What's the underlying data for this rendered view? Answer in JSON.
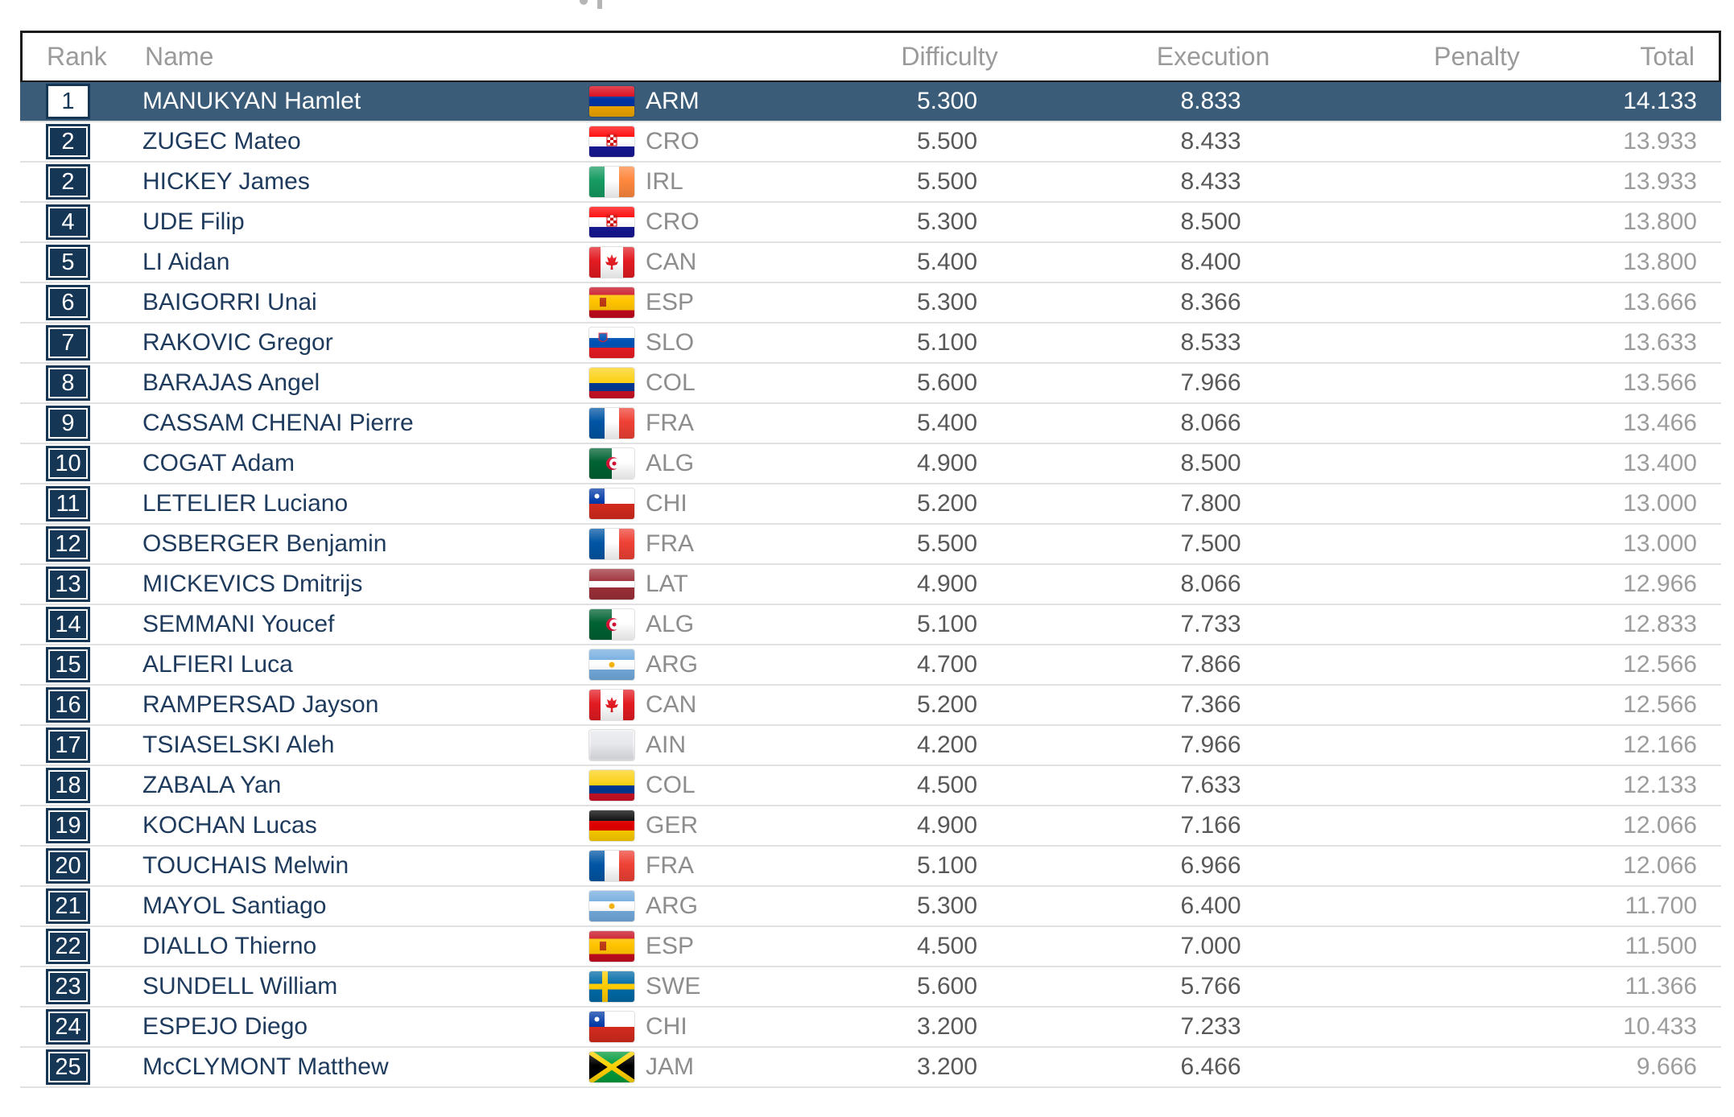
{
  "table": {
    "columns": {
      "rank": "Rank",
      "name": "Name",
      "difficulty": "Difficulty",
      "execution": "Execution",
      "penalty": "Penalty",
      "total": "Total"
    },
    "rows": [
      {
        "rank": "1",
        "name": "MANUKYAN Hamlet",
        "nation": "ARM",
        "flag": "armenia-flag-icon",
        "difficulty": "5.300",
        "execution": "8.833",
        "penalty": "",
        "total": "14.133",
        "highlighted": true
      },
      {
        "rank": "2",
        "name": "ZUGEC Mateo",
        "nation": "CRO",
        "flag": "croatia-flag-icon",
        "difficulty": "5.500",
        "execution": "8.433",
        "penalty": "",
        "total": "13.933"
      },
      {
        "rank": "2",
        "name": "HICKEY James",
        "nation": "IRL",
        "flag": "ireland-flag-icon",
        "difficulty": "5.500",
        "execution": "8.433",
        "penalty": "",
        "total": "13.933"
      },
      {
        "rank": "4",
        "name": "UDE Filip",
        "nation": "CRO",
        "flag": "croatia-flag-icon",
        "difficulty": "5.300",
        "execution": "8.500",
        "penalty": "",
        "total": "13.800"
      },
      {
        "rank": "5",
        "name": "LI Aidan",
        "nation": "CAN",
        "flag": "canada-flag-icon",
        "difficulty": "5.400",
        "execution": "8.400",
        "penalty": "",
        "total": "13.800"
      },
      {
        "rank": "6",
        "name": "BAIGORRI Unai",
        "nation": "ESP",
        "flag": "spain-flag-icon",
        "difficulty": "5.300",
        "execution": "8.366",
        "penalty": "",
        "total": "13.666"
      },
      {
        "rank": "7",
        "name": "RAKOVIC Gregor",
        "nation": "SLO",
        "flag": "slovenia-flag-icon",
        "difficulty": "5.100",
        "execution": "8.533",
        "penalty": "",
        "total": "13.633"
      },
      {
        "rank": "8",
        "name": "BARAJAS Angel",
        "nation": "COL",
        "flag": "colombia-flag-icon",
        "difficulty": "5.600",
        "execution": "7.966",
        "penalty": "",
        "total": "13.566"
      },
      {
        "rank": "9",
        "name": "CASSAM CHENAI Pierre",
        "nation": "FRA",
        "flag": "france-flag-icon",
        "difficulty": "5.400",
        "execution": "8.066",
        "penalty": "",
        "total": "13.466"
      },
      {
        "rank": "10",
        "name": "COGAT Adam",
        "nation": "ALG",
        "flag": "algeria-flag-icon",
        "difficulty": "4.900",
        "execution": "8.500",
        "penalty": "",
        "total": "13.400"
      },
      {
        "rank": "11",
        "name": "LETELIER Luciano",
        "nation": "CHI",
        "flag": "chile-flag-icon",
        "difficulty": "5.200",
        "execution": "7.800",
        "penalty": "",
        "total": "13.000"
      },
      {
        "rank": "12",
        "name": "OSBERGER Benjamin",
        "nation": "FRA",
        "flag": "france-flag-icon",
        "difficulty": "5.500",
        "execution": "7.500",
        "penalty": "",
        "total": "13.000"
      },
      {
        "rank": "13",
        "name": "MICKEVICS Dmitrijs",
        "nation": "LAT",
        "flag": "latvia-flag-icon",
        "difficulty": "4.900",
        "execution": "8.066",
        "penalty": "",
        "total": "12.966"
      },
      {
        "rank": "14",
        "name": "SEMMANI Youcef",
        "nation": "ALG",
        "flag": "algeria-flag-icon",
        "difficulty": "5.100",
        "execution": "7.733",
        "penalty": "",
        "total": "12.833"
      },
      {
        "rank": "15",
        "name": "ALFIERI Luca",
        "nation": "ARG",
        "flag": "argentina-flag-icon",
        "difficulty": "4.700",
        "execution": "7.866",
        "penalty": "",
        "total": "12.566"
      },
      {
        "rank": "16",
        "name": "RAMPERSAD Jayson",
        "nation": "CAN",
        "flag": "canada-flag-icon",
        "difficulty": "5.200",
        "execution": "7.366",
        "penalty": "",
        "total": "12.566"
      },
      {
        "rank": "17",
        "name": "TSIASELSKI Aleh",
        "nation": "AIN",
        "flag": "neutral-flag-icon",
        "difficulty": "4.200",
        "execution": "7.966",
        "penalty": "",
        "total": "12.166"
      },
      {
        "rank": "18",
        "name": "ZABALA Yan",
        "nation": "COL",
        "flag": "colombia-flag-icon",
        "difficulty": "4.500",
        "execution": "7.633",
        "penalty": "",
        "total": "12.133"
      },
      {
        "rank": "19",
        "name": "KOCHAN Lucas",
        "nation": "GER",
        "flag": "germany-flag-icon",
        "difficulty": "4.900",
        "execution": "7.166",
        "penalty": "",
        "total": "12.066"
      },
      {
        "rank": "20",
        "name": "TOUCHAIS Melwin",
        "nation": "FRA",
        "flag": "france-flag-icon",
        "difficulty": "5.100",
        "execution": "6.966",
        "penalty": "",
        "total": "12.066"
      },
      {
        "rank": "21",
        "name": "MAYOL Santiago",
        "nation": "ARG",
        "flag": "argentina-flag-icon",
        "difficulty": "5.300",
        "execution": "6.400",
        "penalty": "",
        "total": "11.700"
      },
      {
        "rank": "22",
        "name": "DIALLO Thierno",
        "nation": "ESP",
        "flag": "spain-flag-icon",
        "difficulty": "4.500",
        "execution": "7.000",
        "penalty": "",
        "total": "11.500"
      },
      {
        "rank": "23",
        "name": "SUNDELL William",
        "nation": "SWE",
        "flag": "sweden-flag-icon",
        "difficulty": "5.600",
        "execution": "5.766",
        "penalty": "",
        "total": "11.366"
      },
      {
        "rank": "24",
        "name": "ESPEJO Diego",
        "nation": "CHI",
        "flag": "chile-flag-icon",
        "difficulty": "3.200",
        "execution": "7.233",
        "penalty": "",
        "total": "10.433"
      },
      {
        "rank": "25",
        "name": "McCLYMONT Matthew",
        "nation": "JAM",
        "flag": "jamaica-flag-icon",
        "difficulty": "3.200",
        "execution": "6.466",
        "penalty": "",
        "total": "9.666"
      }
    ]
  },
  "colors": {
    "highlight_row": "#3b5c79",
    "rank_box": "#163656",
    "grid_line": "#e1e1e1",
    "header_text": "#9a9a9a",
    "name_text": "#1e3a5c"
  }
}
